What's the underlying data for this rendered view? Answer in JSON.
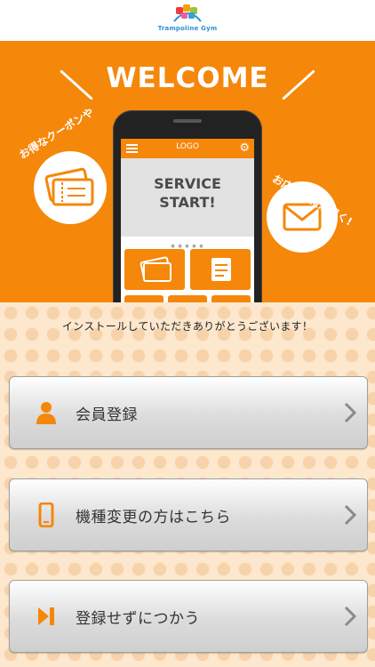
{
  "brand": {
    "name": "Trampoline Gym"
  },
  "hero": {
    "welcome": "WELCOME",
    "phone_logo": "LOGO",
    "phone_banner_line1": "SERVICE",
    "phone_banner_line2": "START!",
    "coupon_text": "お得なクーポンや",
    "info_text": "お店の情報が届く!"
  },
  "thanks": "インストールしていただきありがとうございます！",
  "buttons": {
    "register": {
      "label": "会員登録",
      "icon": "person-icon"
    },
    "device_change": {
      "label": "機種変更の方はこちら",
      "icon": "smartphone-icon"
    },
    "skip": {
      "label": "登録せずにつかう",
      "icon": "skip-icon"
    }
  },
  "colors": {
    "accent": "#f5870a",
    "background": "#fde7cd"
  }
}
